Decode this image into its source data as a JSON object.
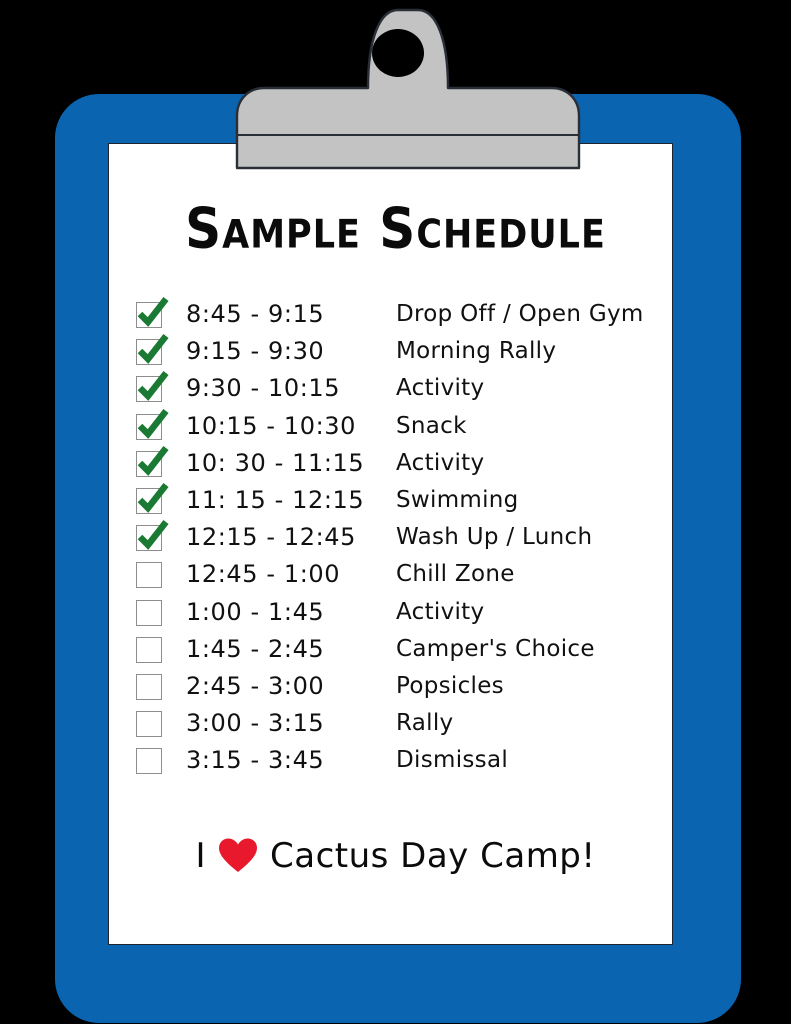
{
  "colors": {
    "board_blue": "#0b64b0",
    "paper_white": "#ffffff",
    "clip_gray": "#c3c3c3",
    "check_green": "#1a7a33",
    "heart_red": "#e8192c",
    "ink_black": "#111111",
    "background": "#000000"
  },
  "title": "Sample Schedule",
  "schedule": {
    "rows": [
      {
        "checked": true,
        "time": "8:45 - 9:15",
        "activity": "Drop Off / Open Gym"
      },
      {
        "checked": true,
        "time": "9:15 - 9:30",
        "activity": "Morning Rally"
      },
      {
        "checked": true,
        "time": "9:30 - 10:15",
        "activity": "Activity"
      },
      {
        "checked": true,
        "time": "10:15 - 10:30",
        "activity": "Snack"
      },
      {
        "checked": true,
        "time": "10: 30 - 11:15",
        "activity": "Activity"
      },
      {
        "checked": true,
        "time": "11: 15 - 12:15",
        "activity": "Swimming"
      },
      {
        "checked": true,
        "time": "12:15 - 12:45",
        "activity": "Wash Up / Lunch"
      },
      {
        "checked": false,
        "time": "12:45 - 1:00",
        "activity": "Chill Zone"
      },
      {
        "checked": false,
        "time": "1:00 - 1:45",
        "activity": "Activity"
      },
      {
        "checked": false,
        "time": "1:45 - 2:45",
        "activity": "Camper's Choice"
      },
      {
        "checked": false,
        "time": "2:45 - 3:00",
        "activity": "Popsicles"
      },
      {
        "checked": false,
        "time": "3:00 - 3:15",
        "activity": "Rally"
      },
      {
        "checked": false,
        "time": "3:15 - 3:45",
        "activity": "Dismissal"
      }
    ]
  },
  "footer": {
    "prefix": "I",
    "heart_icon": "heart-icon",
    "suffix": "Cactus Day Camp!"
  },
  "clipboard": {
    "clip_icon": "clipboard-clip-icon",
    "board_name": "clipboard-board",
    "paper_name": "paper-sheet"
  }
}
